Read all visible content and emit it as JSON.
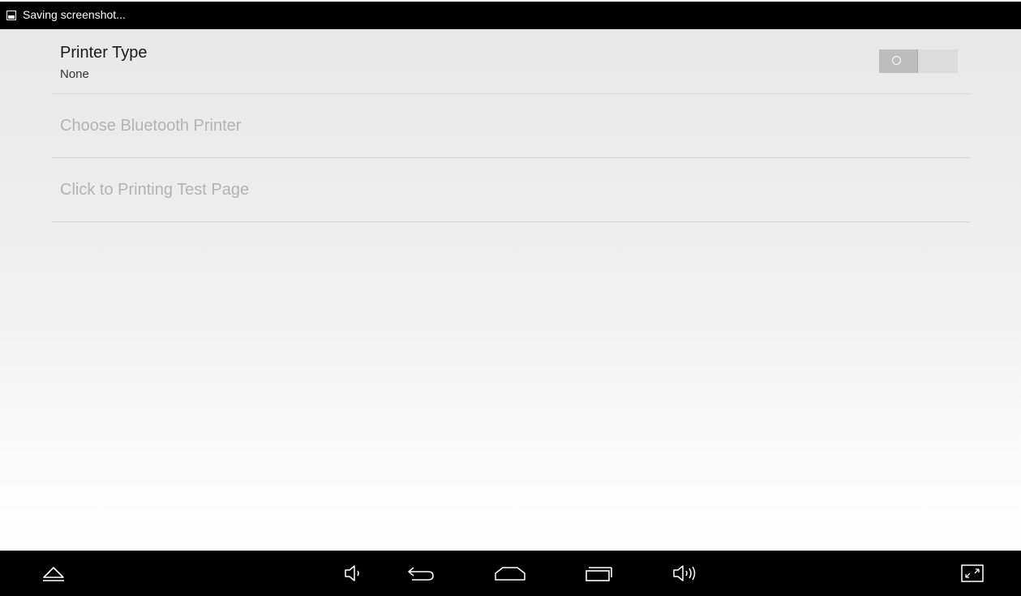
{
  "status_bar": {
    "notification_icon": "image-icon",
    "notification_text": "Saving screenshot..."
  },
  "settings": {
    "printer_type": {
      "title": "Printer Type",
      "summary": "None",
      "toggle_enabled": false
    },
    "bluetooth_printer": {
      "title": "Choose Bluetooth Printer",
      "enabled": false
    },
    "test_page": {
      "title": "Click to Printing Test Page",
      "enabled": false
    }
  },
  "nav_bar": {
    "icons": [
      "hide-nav-icon",
      "volume-down-icon",
      "back-icon",
      "home-icon",
      "recent-apps-icon",
      "volume-up-icon",
      "screenshot-icon"
    ]
  },
  "colors": {
    "status_bar": "#000000",
    "nav_bar": "#000000",
    "text_primary": "#1a1a1a",
    "text_disabled": "#b3b3b3",
    "divider": "#d6d6d6"
  }
}
